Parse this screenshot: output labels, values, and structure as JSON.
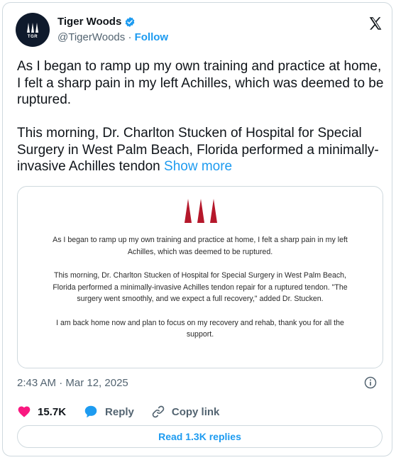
{
  "author": {
    "display_name": "Tiger Woods",
    "handle": "@TigerWoods",
    "separator": "·",
    "follow_label": "Follow",
    "avatar_text": "TGR",
    "verified": true
  },
  "tweet": {
    "text": "As I began to ramp up my own training and practice at home, I felt a sharp pain in my left Achilles, which was deemed to be ruptured.\n\nThis morning, Dr. Charlton Stucken of Hospital for Special Surgery in West Palm Beach, Florida performed a minimally-invasive Achilles tendon ",
    "show_more_label": "Show more"
  },
  "media": {
    "paragraphs": [
      "As I began to ramp up my own training and practice at home, I felt a sharp pain in my left Achilles, which was deemed to be ruptured.",
      "This morning, Dr. Charlton Stucken of Hospital for Special Surgery in West Palm Beach, Florida performed a minimally-invasive Achilles tendon repair for a ruptured tendon. \"The surgery went smoothly, and we expect a full recovery,\" added Dr. Stucken.",
      "I am back home now and plan to focus on my recovery and rehab, thank you for all the support."
    ],
    "logo_color": "#b5182b"
  },
  "meta": {
    "timestamp": "2:43 AM · Mar 12, 2025"
  },
  "actions": {
    "likes": "15.7K",
    "reply_label": "Reply",
    "copy_link_label": "Copy link"
  },
  "replies_button_label": "Read 1.3K replies",
  "colors": {
    "accent": "#1d9bf0",
    "like": "#f91880",
    "secondary_text": "#536471",
    "border": "#cfd9de"
  },
  "icons": [
    "verified-badge-icon",
    "x-logo-icon",
    "info-icon",
    "heart-icon",
    "reply-bubble-icon",
    "link-icon"
  ]
}
